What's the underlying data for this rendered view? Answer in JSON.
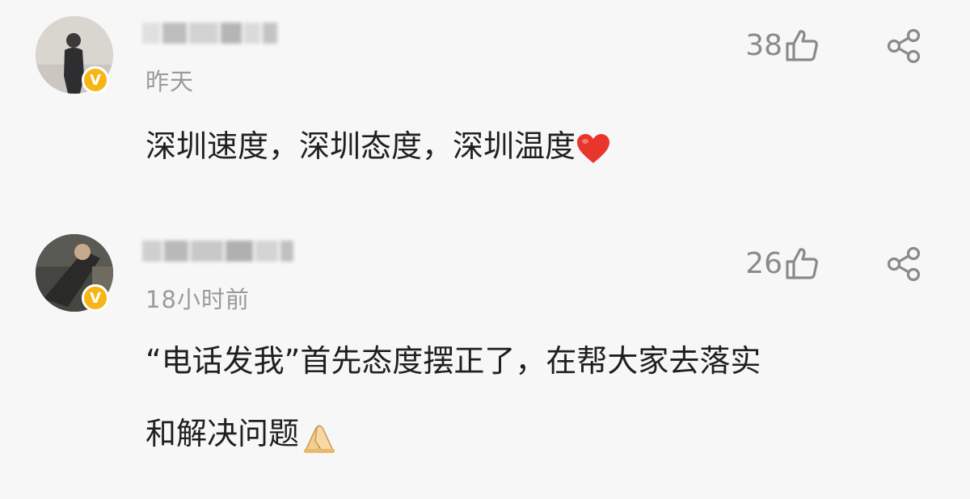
{
  "comments": [
    {
      "time": "昨天",
      "likes": "38",
      "text": "深圳速度，深圳态度，深圳温度",
      "emoji": "heart-icon",
      "verified_badge": "V"
    },
    {
      "time": "18小时前",
      "likes": "26",
      "text_line1": "“电话发我”首先态度摆正了，在帮大家去落实",
      "text_line2": "和解决问题",
      "emoji": "pray-hands-icon",
      "verified_badge": "V"
    }
  ],
  "colors": {
    "background": "#f7f7f7",
    "meta_text": "#9a9a9a",
    "icon": "#8a8a8a",
    "badge": "#f6b615",
    "heart": "#e8362d"
  }
}
